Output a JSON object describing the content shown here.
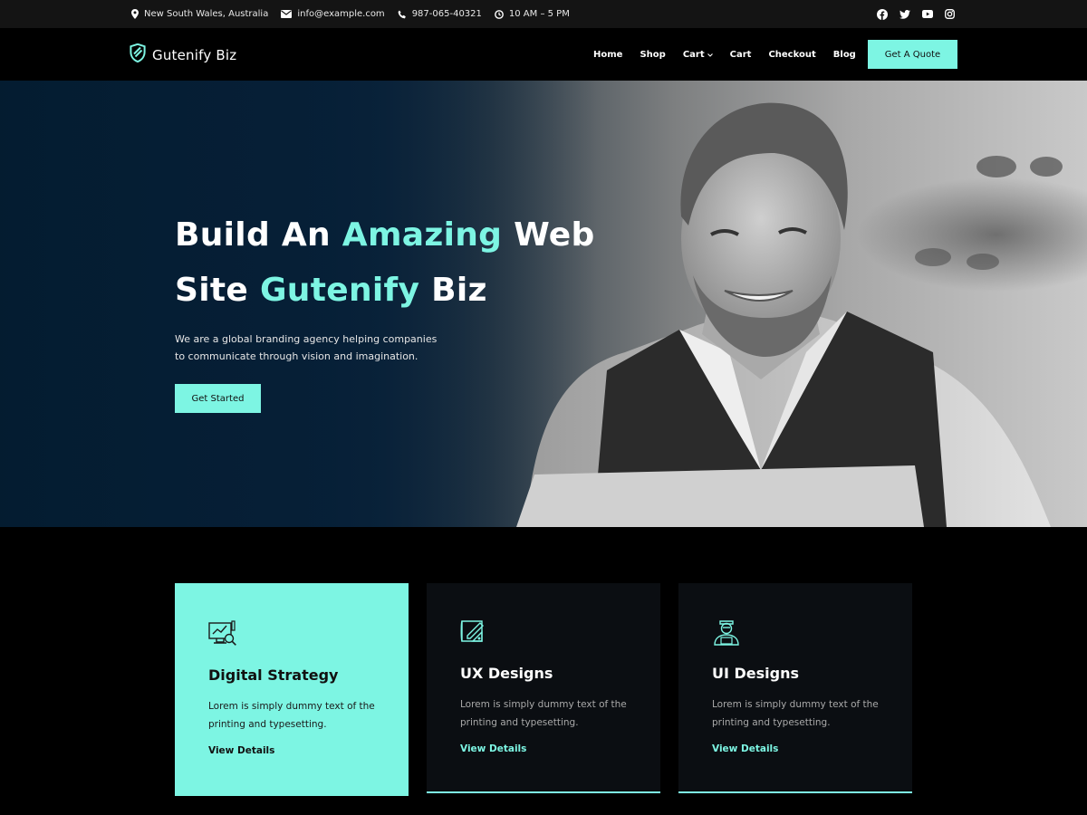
{
  "topbar": {
    "location": "New South Wales, Australia",
    "email": "info@example.com",
    "phone": "987-065-40321",
    "hours": "10 AM – 5 PM",
    "social": [
      "facebook-icon",
      "twitter-icon",
      "youtube-icon",
      "instagram-icon"
    ]
  },
  "header": {
    "logo_text": "Gutenify Biz",
    "nav": [
      {
        "label": "Home"
      },
      {
        "label": "Shop"
      },
      {
        "label": "Cart",
        "has_dropdown": true
      },
      {
        "label": "Cart"
      },
      {
        "label": "Checkout"
      },
      {
        "label": "Blog"
      }
    ],
    "quote_button": "Get A Quote"
  },
  "hero": {
    "title_part1": "Build An ",
    "title_hl1": "Amazing",
    "title_part2": " Web",
    "title_part3": "Site ",
    "title_hl2": "Gutenify",
    "title_part4": " Biz",
    "description": "We are a global branding agency helping companies to communicate through vision and imagination.",
    "cta_label": "Get Started"
  },
  "services": [
    {
      "title": "Digital Strategy",
      "text": "Lorem is simply dummy text of the printing and typesetting.",
      "link": "View Details",
      "icon": "strategy-icon"
    },
    {
      "title": "UX Designs",
      "text": "Lorem is simply dummy text of the printing and typesetting.",
      "link": "View Details",
      "icon": "ux-design-icon"
    },
    {
      "title": "UI Designs",
      "text": "Lorem is simply dummy text of the printing and typesetting.",
      "link": "View Details",
      "icon": "ui-design-icon"
    }
  ],
  "colors": {
    "accent": "#7df5e3",
    "background": "#000000",
    "card": "#0b0e12",
    "topbar": "#141414"
  }
}
